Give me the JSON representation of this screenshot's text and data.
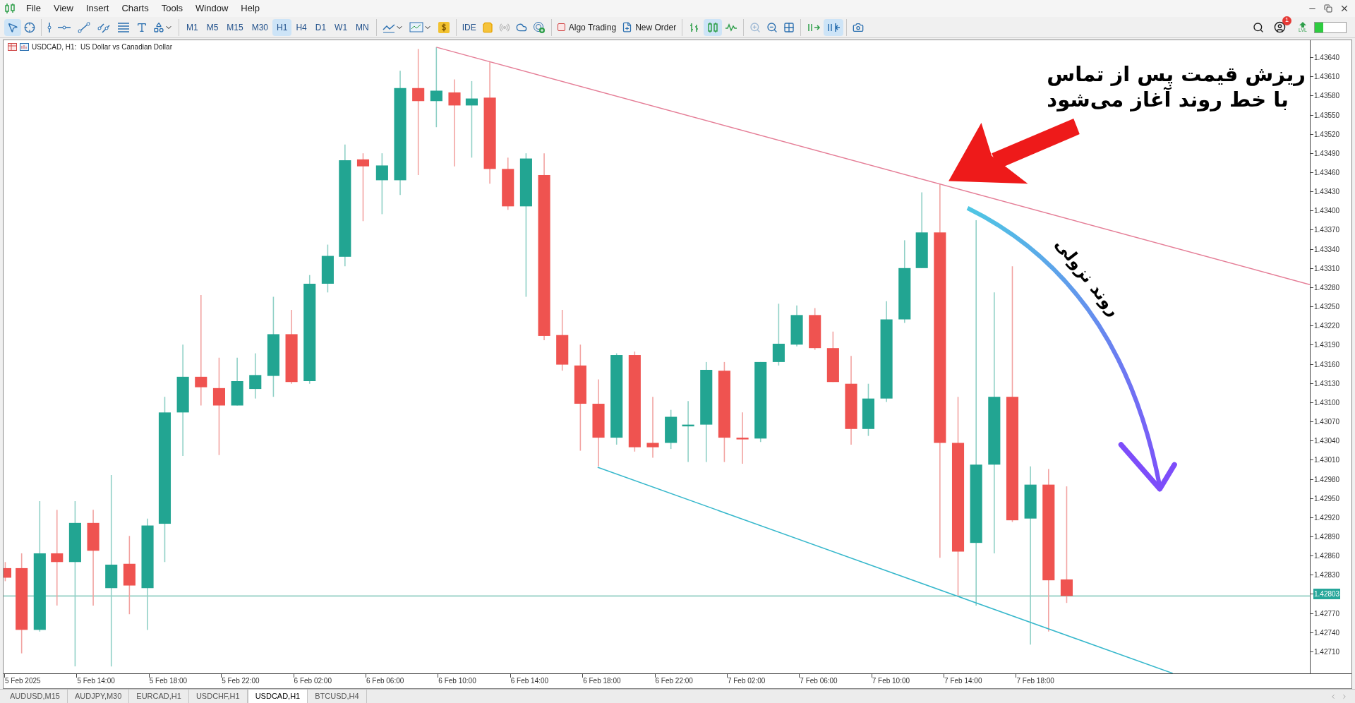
{
  "menu": [
    "File",
    "View",
    "Insert",
    "Charts",
    "Tools",
    "Window",
    "Help"
  ],
  "toolbar": {
    "timeframes": [
      {
        "label": "M1",
        "selected": false
      },
      {
        "label": "M5",
        "selected": false
      },
      {
        "label": "M15",
        "selected": false
      },
      {
        "label": "M30",
        "selected": false
      },
      {
        "label": "H1",
        "selected": true
      },
      {
        "label": "H4",
        "selected": false
      },
      {
        "label": "D1",
        "selected": false
      },
      {
        "label": "W1",
        "selected": false
      },
      {
        "label": "MN",
        "selected": false
      }
    ],
    "ide": "IDE",
    "algo_trading": "Algo Trading",
    "new_order": "New Order",
    "chart_modes": [
      {
        "kind": "bars",
        "selected": false
      },
      {
        "kind": "candles",
        "selected": true
      },
      {
        "kind": "line",
        "selected": false
      }
    ],
    "auto_scroll": false,
    "chart_shift": true,
    "notification_count": "1",
    "level_label": "LVL"
  },
  "chart": {
    "title": "USDCAD, H1:  US Dollar vs Canadian Dollar",
    "price_labels": [
      {
        "kind": "tick",
        "label": "1.43640"
      },
      {
        "kind": "tick",
        "label": "1.43610"
      },
      {
        "kind": "tick",
        "label": "1.43580"
      },
      {
        "kind": "tick",
        "label": "1.43550"
      },
      {
        "kind": "tick",
        "label": "1.43520"
      },
      {
        "kind": "tick",
        "label": "1.43490"
      },
      {
        "kind": "tick",
        "label": "1.43460"
      },
      {
        "kind": "tick",
        "label": "1.43430"
      },
      {
        "kind": "tick",
        "label": "1.43400"
      },
      {
        "kind": "tick",
        "label": "1.43370"
      },
      {
        "kind": "tick",
        "label": "1.43340"
      },
      {
        "kind": "tick",
        "label": "1.43310"
      },
      {
        "kind": "tick",
        "label": "1.43280"
      },
      {
        "kind": "tick",
        "label": "1.43250"
      },
      {
        "kind": "tick",
        "label": "1.43220"
      },
      {
        "kind": "tick",
        "label": "1.43190"
      },
      {
        "kind": "tick",
        "label": "1.43160"
      },
      {
        "kind": "tick",
        "label": "1.43130"
      },
      {
        "kind": "tick",
        "label": "1.43100"
      },
      {
        "kind": "tick",
        "label": "1.43070"
      },
      {
        "kind": "tick",
        "label": "1.43040"
      },
      {
        "kind": "tick",
        "label": "1.43010"
      },
      {
        "kind": "tick",
        "label": "1.42980"
      },
      {
        "kind": "tick",
        "label": "1.42950"
      },
      {
        "kind": "tick",
        "label": "1.42920"
      },
      {
        "kind": "tick",
        "label": "1.42890"
      },
      {
        "kind": "tick",
        "label": "1.42860"
      },
      {
        "kind": "tick",
        "label": "1.42830"
      },
      {
        "kind": "current",
        "label": "1.42803"
      },
      {
        "kind": "tick",
        "label": "1.42770"
      },
      {
        "kind": "tick",
        "label": "1.42740"
      },
      {
        "kind": "tick",
        "label": "1.42710"
      }
    ],
    "time_labels": [
      "5 Feb 2025",
      "5 Feb 14:00",
      "5 Feb 18:00",
      "5 Feb 22:00",
      "6 Feb 02:00",
      "6 Feb 06:00",
      "6 Feb 10:00",
      "6 Feb 14:00",
      "6 Feb 18:00",
      "6 Feb 22:00",
      "7 Feb 02:00",
      "7 Feb 06:00",
      "7 Feb 10:00",
      "7 Feb 14:00",
      "7 Feb 18:00"
    ],
    "annotation": {
      "headline": [
        "ریزش قیمت پس از تماس",
        "با خط روند آغاز می‌شود"
      ],
      "curve_label": "روند نزولی"
    }
  },
  "tabs": [
    {
      "label": "AUDUSD,M15",
      "selected": false
    },
    {
      "label": "AUDJPY,M30",
      "selected": false
    },
    {
      "label": "EURCAD,H1",
      "selected": false
    },
    {
      "label": "USDCHF,H1",
      "selected": false
    },
    {
      "label": "USDCAD,H1",
      "selected": true
    },
    {
      "label": "BTCUSD,H4",
      "selected": false
    }
  ]
}
